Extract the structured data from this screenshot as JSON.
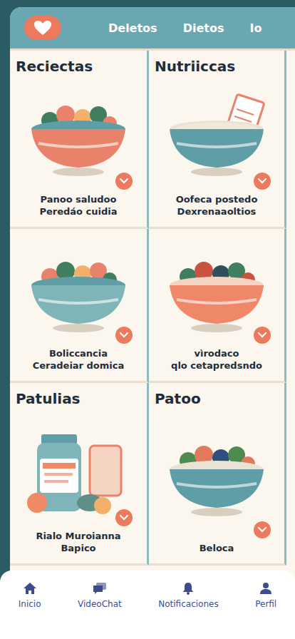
{
  "tabs": [
    {
      "label": "Deletos",
      "selected": false
    },
    {
      "label": "Dietos",
      "selected": false
    },
    {
      "label": "Io",
      "selected": false
    }
  ],
  "cards": [
    {
      "title": "Reciectas",
      "kind": "bowl",
      "caption": [
        "Panoo saludoo",
        "Peredáo cuidia"
      ]
    },
    {
      "title": "Nutriiccas",
      "kind": "soup",
      "caption": [
        "Oofeca postedo",
        "Dexrenaaoltios"
      ]
    },
    {
      "title": "",
      "kind": "bowl",
      "caption": [
        "Boliccancia",
        "Ceradeiar domica"
      ]
    },
    {
      "title": "",
      "kind": "bowl",
      "caption": [
        "vìrodaco",
        "qlo cetapredsndo"
      ]
    },
    {
      "title": "Patulias",
      "kind": "jar",
      "caption": [
        "Rialo Muroianna",
        "Bapico"
      ]
    },
    {
      "title": "Patoo",
      "kind": "bowl",
      "caption": [
        "Beloca"
      ]
    }
  ],
  "nav": [
    {
      "label": "Inicio",
      "kind": "home"
    },
    {
      "label": "VideoChat",
      "kind": "chat"
    },
    {
      "label": "Notificaciones",
      "kind": "bell"
    },
    {
      "label": "Perfil",
      "kind": "user"
    }
  ]
}
